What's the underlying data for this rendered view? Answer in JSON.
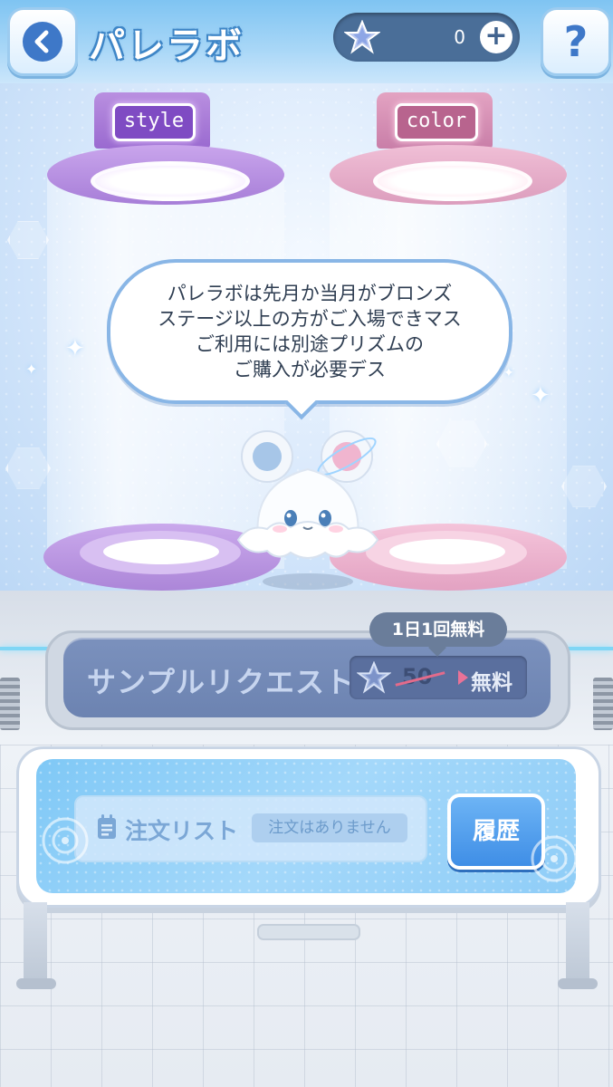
{
  "header": {
    "title": "パレラボ",
    "prism_count": "0",
    "plus_label": "+",
    "help_label": "?"
  },
  "machines": {
    "style_label": "style",
    "color_label": "color"
  },
  "speech": {
    "lines": [
      "パレラボは先月か当月がブロンズ",
      "ステージ以上の方がご入場できマス",
      "ご利用には別途プリズムの",
      "ご購入が必要デス"
    ]
  },
  "sample_request": {
    "label": "サンプルリクエスト",
    "badge": "1日1回無料",
    "old_price": "50",
    "new_price": "無料"
  },
  "order": {
    "title": "注文リスト",
    "status": "注文はありません",
    "history_label": "履歴"
  },
  "colors": {
    "style_purple": "#a97ad6",
    "color_pink": "#e59bc0",
    "accent_blue": "#3f8ee6"
  }
}
